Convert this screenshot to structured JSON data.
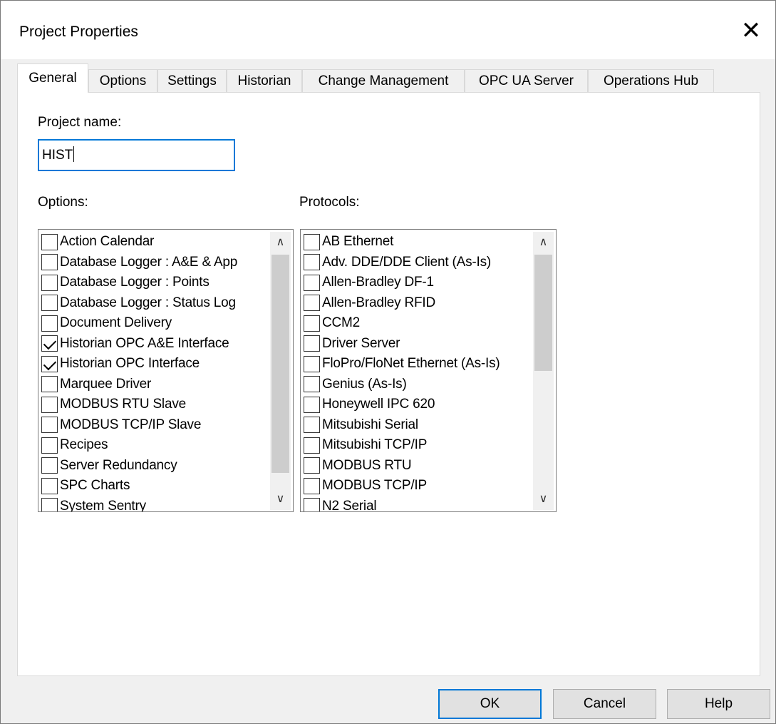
{
  "window": {
    "title": "Project Properties",
    "close_glyph": "✕"
  },
  "tabs": [
    {
      "label": "General",
      "active": true
    },
    {
      "label": "Options"
    },
    {
      "label": "Settings"
    },
    {
      "label": "Historian"
    },
    {
      "label": "Change Management"
    },
    {
      "label": "OPC UA Server"
    },
    {
      "label": "Operations Hub"
    }
  ],
  "general": {
    "project_name_label": "Project name:",
    "project_name_value": "HIST",
    "options_label": "Options:",
    "protocols_label": "Protocols:"
  },
  "options": [
    {
      "label": "Action Calendar",
      "checked": false
    },
    {
      "label": "Database Logger : A&E & App",
      "checked": false
    },
    {
      "label": "Database Logger : Points",
      "checked": false
    },
    {
      "label": "Database Logger : Status Log",
      "checked": false
    },
    {
      "label": "Document Delivery",
      "checked": false
    },
    {
      "label": "Historian OPC A&E Interface",
      "checked": true
    },
    {
      "label": "Historian OPC Interface",
      "checked": true
    },
    {
      "label": "Marquee Driver",
      "checked": false
    },
    {
      "label": "MODBUS RTU Slave",
      "checked": false
    },
    {
      "label": "MODBUS TCP/IP Slave",
      "checked": false
    },
    {
      "label": "Recipes",
      "checked": false
    },
    {
      "label": "Server Redundancy",
      "checked": false
    },
    {
      "label": "SPC Charts",
      "checked": false
    },
    {
      "label": "System Sentry",
      "checked": false
    }
  ],
  "protocols": [
    {
      "label": "AB Ethernet",
      "checked": false
    },
    {
      "label": "Adv. DDE/DDE Client (As-Is)",
      "checked": false
    },
    {
      "label": "Allen-Bradley DF-1",
      "checked": false
    },
    {
      "label": "Allen-Bradley RFID",
      "checked": false
    },
    {
      "label": "CCM2",
      "checked": false
    },
    {
      "label": "Driver Server",
      "checked": false
    },
    {
      "label": "FloPro/FloNet Ethernet (As-Is)",
      "checked": false
    },
    {
      "label": "Genius (As-Is)",
      "checked": false
    },
    {
      "label": "Honeywell IPC 620",
      "checked": false
    },
    {
      "label": "Mitsubishi Serial",
      "checked": false
    },
    {
      "label": "Mitsubishi TCP/IP",
      "checked": false
    },
    {
      "label": "MODBUS RTU",
      "checked": false
    },
    {
      "label": "MODBUS TCP/IP",
      "checked": false
    },
    {
      "label": "N2 Serial",
      "checked": false
    }
  ],
  "scrollbars": {
    "up_glyph": "∧",
    "down_glyph": "∨"
  },
  "buttons": {
    "ok": "OK",
    "cancel": "Cancel",
    "help": "Help"
  }
}
